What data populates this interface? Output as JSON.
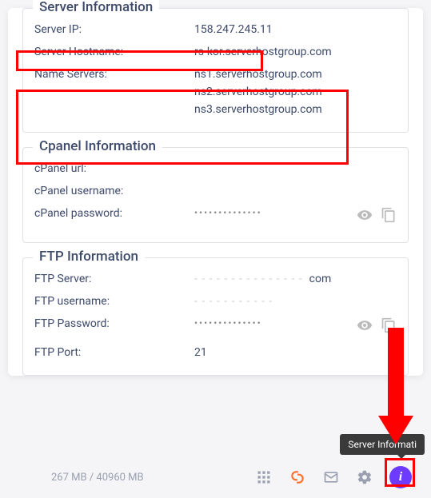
{
  "sections": {
    "server": {
      "title": "Server Information",
      "ip_label": "Server IP:",
      "ip_value": "158.247.245.11",
      "hostname_label": "Server Hostname:",
      "hostname_value": "rs-kor.serverhostgroup.com",
      "ns_label": "Name Servers:",
      "ns1": "ns1.serverhostgroup.com",
      "ns2": "ns2.serverhostgroup.com",
      "ns3": "ns3.serverhostgroup.com"
    },
    "cpanel": {
      "title": "Cpanel Information",
      "url_label": "cPanel url:",
      "user_label": "cPanel username:",
      "pass_label": "cPanel password:",
      "pass_mask": "••••••••••••••"
    },
    "ftp": {
      "title": "FTP Information",
      "server_label": "FTP Server:",
      "server_suffix": "com",
      "user_label": "FTP username:",
      "pass_label": "FTP Password:",
      "pass_mask": "••••••••••••••",
      "port_label": "FTP Port:",
      "port_value": "21"
    }
  },
  "footer": {
    "stats": "267 MB / 40960 MB",
    "tooltip": "Server Informati"
  },
  "icons": {
    "eye": "eye-icon",
    "copy": "copy-icon",
    "apps": "apps-icon",
    "cp": "cpanel-icon",
    "mail": "mail-icon",
    "gear": "gear-icon",
    "info": "info-icon"
  },
  "colors": {
    "accent": "#6d3bff",
    "cpanel_orange": "#ff6c2c",
    "highlight": "#ff0000"
  }
}
